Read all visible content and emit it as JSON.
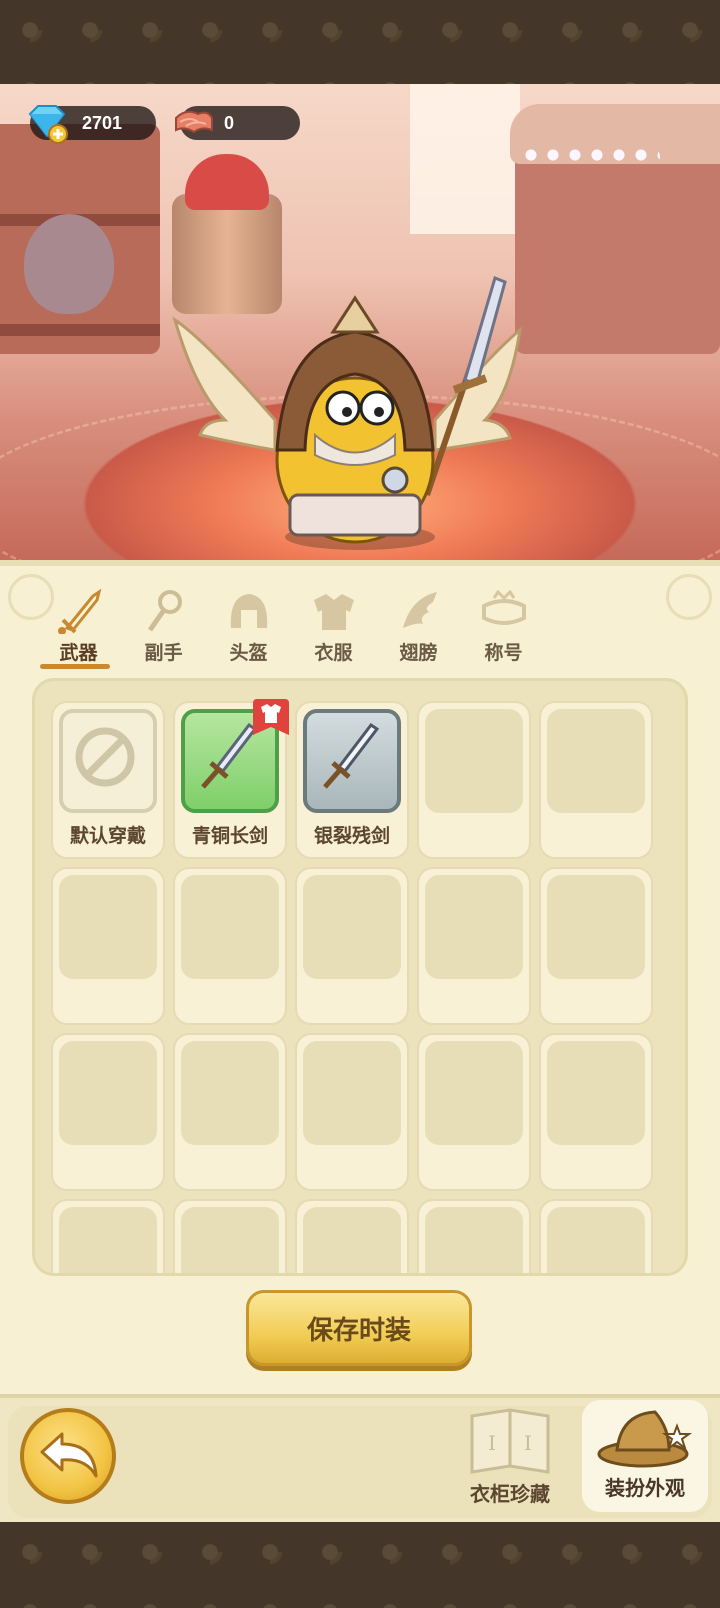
{
  "currencies": {
    "gems": "2701",
    "cloth": "0"
  },
  "tabs": [
    {
      "label": "武器",
      "icon": "sword-icon",
      "active": true
    },
    {
      "label": "副手",
      "icon": "offhand-icon",
      "active": false
    },
    {
      "label": "头盔",
      "icon": "helmet-icon",
      "active": false
    },
    {
      "label": "衣服",
      "icon": "armor-icon",
      "active": false
    },
    {
      "label": "翅膀",
      "icon": "wing-icon",
      "active": false
    },
    {
      "label": "称号",
      "icon": "title-icon",
      "active": false
    }
  ],
  "items": [
    {
      "name": "默认穿戴",
      "type": "default"
    },
    {
      "name": "青铜长剑",
      "type": "green",
      "equipped_badge": true
    },
    {
      "name": "银裂残剑",
      "type": "grey"
    }
  ],
  "save_button": "保存时装",
  "bottom": {
    "wardrobe": "衣柜珍藏",
    "dressup": "装扮外观"
  },
  "colors": {
    "accent": "#c9892f",
    "panel": "#f7f0d2",
    "green_rarity": "#7fcf6a",
    "grey_rarity": "#a9b7ba"
  }
}
